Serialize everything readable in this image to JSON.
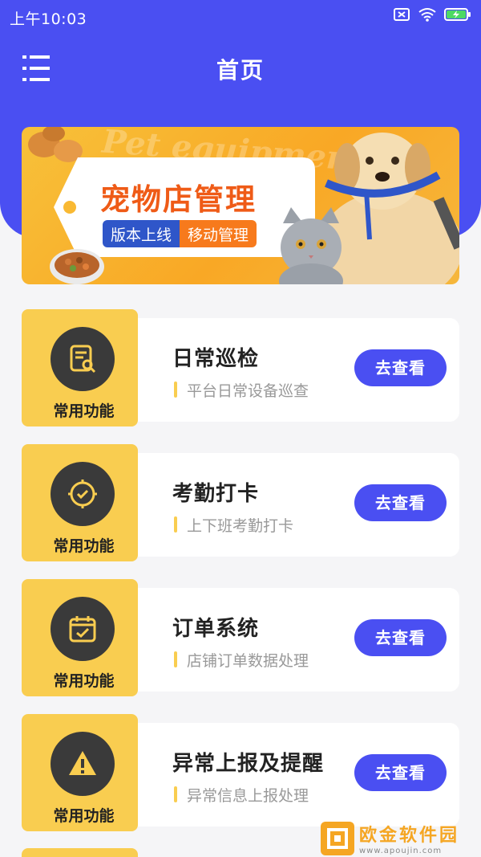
{
  "status_bar": {
    "time": "上午10:03",
    "icons": [
      "sim-off-icon",
      "wifi-icon",
      "battery-charging-icon"
    ]
  },
  "nav": {
    "title": "首页",
    "menu_icon": "menu-list-icon"
  },
  "banner": {
    "watermark_text": "Pet equipment",
    "title": "宠物店管理",
    "pill_left": "版本上线",
    "pill_right": "移动管理"
  },
  "cards": [
    {
      "icon": "report-search-icon",
      "badge": "常用功能",
      "title": "日常巡检",
      "subtitle": "平台日常设备巡查",
      "button": "去查看"
    },
    {
      "icon": "clock-check-icon",
      "badge": "常用功能",
      "title": "考勤打卡",
      "subtitle": "上下班考勤打卡",
      "button": "去查看"
    },
    {
      "icon": "calendar-check-icon",
      "badge": "常用功能",
      "title": "订单系统",
      "subtitle": "店铺订单数据处理",
      "button": "去查看"
    },
    {
      "icon": "warning-icon",
      "badge": "常用功能",
      "title": "异常上报及提醒",
      "subtitle": "异常信息上报处理",
      "button": "去查看"
    }
  ],
  "watermark": {
    "name": "欧金软件园",
    "url": "www.apoujin.com"
  },
  "colors": {
    "primary": "#4a4ff2",
    "badge_yellow": "#f9cd50",
    "background": "#f5f5f7"
  }
}
